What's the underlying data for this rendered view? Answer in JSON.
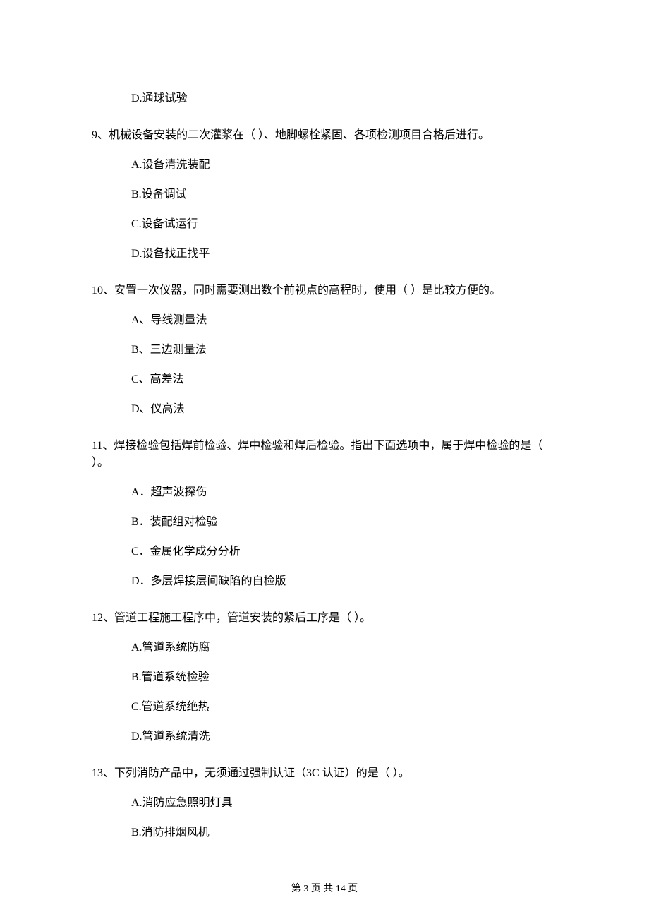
{
  "leading_option": "D.通球试验",
  "questions": [
    {
      "label": "9、机械设备安装的二次灌浆在（    ）、地脚螺栓紧固、各项检测项目合格后进行。",
      "options": [
        "A.设备清洗装配",
        "B.设备调试",
        "C.设备试运行",
        "D.设备找正找平"
      ]
    },
    {
      "label": "10、安置一次仪器，同时需要测出数个前视点的高程时，使用（    ）是比较方便的。",
      "options": [
        "A、导线测量法",
        "B、三边测量法",
        "C、高差法",
        "D、仪高法"
      ]
    },
    {
      "label": "11、焊接检验包括焊前检验、焊中检验和焊后检验。指出下面选项中，属于焊中检验的是（    ）。",
      "options": [
        "A．超声波探伤",
        "B．装配组对检验",
        "C．金属化学成分分析",
        "D．多层焊接层间缺陷的自检版"
      ]
    },
    {
      "label": "12、管道工程施工程序中，管道安装的紧后工序是（    ）。",
      "options": [
        "A.管道系统防腐",
        "B.管道系统检验",
        "C.管道系统绝热",
        "D.管道系统清洗"
      ]
    },
    {
      "label": "13、下列消防产品中，无须通过强制认证（3C 认证）的是（    ）。",
      "options": [
        "A.消防应急照明灯具",
        "B.消防排烟风机"
      ]
    }
  ],
  "footer": "第 3 页 共 14 页"
}
